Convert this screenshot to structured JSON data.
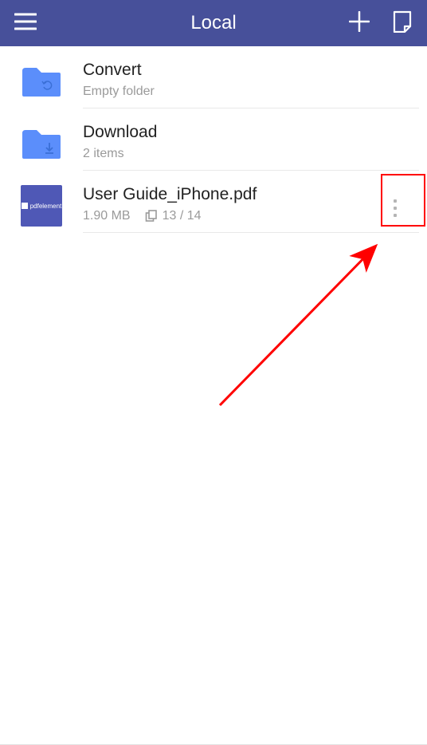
{
  "header": {
    "title": "Local"
  },
  "items": {
    "convert": {
      "title": "Convert",
      "subtitle": "Empty folder"
    },
    "download": {
      "title": "Download",
      "subtitle": "2 items"
    },
    "file": {
      "title": "User Guide_iPhone.pdf",
      "size": "1.90 MB",
      "pages": "13 / 14",
      "thumb_brand": "pdfelement"
    }
  },
  "colors": {
    "header_bg": "#47509a",
    "folder": "#5b8efb",
    "annotation": "#ff0000"
  }
}
